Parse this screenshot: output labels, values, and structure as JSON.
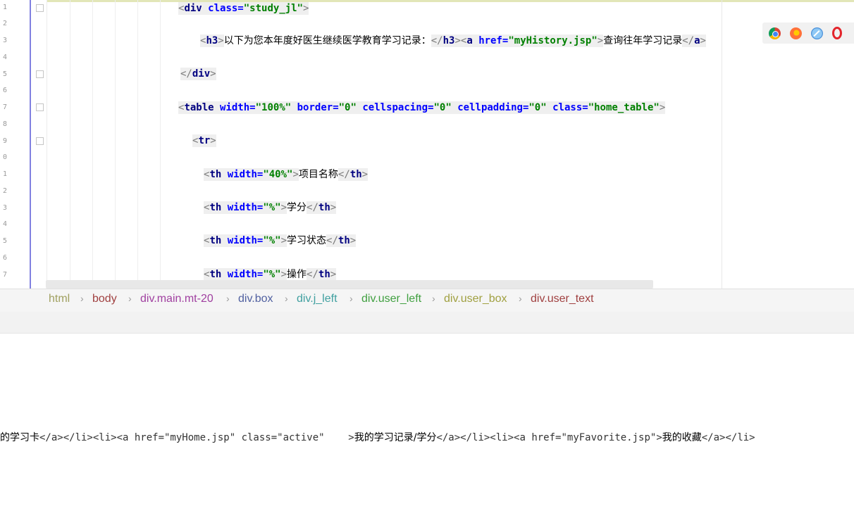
{
  "editor": {
    "line_numbers": [
      "1",
      "2",
      "3",
      "4",
      "5",
      "6",
      "7",
      "8",
      "9",
      "0",
      "1",
      "2",
      "3",
      "4",
      "5",
      "6",
      "7"
    ],
    "lines": {
      "l1": {
        "open": "<",
        "tag": "div",
        "a1": " class=",
        "v1": "\"study_jl\"",
        "close": ">"
      },
      "l3": {
        "o1": "<",
        "t1": "h3",
        "c1": ">",
        "text1": "以下为您本年度好医生继续医学教育学习记录：",
        "o2": "</",
        "t2": "h3",
        "c2": ">",
        "o3": "<",
        "t3": "a",
        "a3": " href=",
        "v3": "\"myHistory.jsp\"",
        "c3": ">",
        "text2": "查询往年学习记录",
        "o4": "</",
        "t4": "a",
        "c4": ">"
      },
      "l5": {
        "open": "</",
        "tag": "div",
        "close": ">"
      },
      "l7": {
        "open": "<",
        "tag": "table",
        "a1": " width=",
        "v1": "\"100%\"",
        "a2": " border=",
        "v2": "\"0\"",
        "a3": " cellspacing=",
        "v3": "\"0\"",
        "a4": " cellpadding=",
        "v4": "\"0\"",
        "a5": " class=",
        "v5": "\"home_table\"",
        "close": ">"
      },
      "l9": {
        "open": "<",
        "tag": "tr",
        "close": ">"
      },
      "l11": {
        "open": "<",
        "tag": "th",
        "a1": " width=",
        "v1": "\"40%\"",
        "close": ">",
        "text": "项目名称",
        "eo": "</",
        "etag": "th",
        "ec": ">"
      },
      "l13": {
        "open": "<",
        "tag": "th",
        "a1": " width=",
        "v1": "\"%\"",
        "close": ">",
        "text": "学分",
        "eo": "</",
        "etag": "th",
        "ec": ">"
      },
      "l15": {
        "open": "<",
        "tag": "th",
        "a1": " width=",
        "v1": "\"%\"",
        "close": ">",
        "text": "学习状态",
        "eo": "</",
        "etag": "th",
        "ec": ">"
      },
      "l17": {
        "open": "<",
        "tag": "th",
        "a1": " width=",
        "v1": "\"%\"",
        "close": ">",
        "text": "操作",
        "eo": "</",
        "etag": "th",
        "ec": ">"
      }
    }
  },
  "browser_icons": [
    "chrome-icon",
    "firefox-icon",
    "safari-icon",
    "opera-icon"
  ],
  "breadcrumb": {
    "items": [
      {
        "label": "html",
        "color": "#a0a060"
      },
      {
        "label": "body",
        "color": "#a04040"
      },
      {
        "label": "div.main.mt-20",
        "color": "#a040a0"
      },
      {
        "label": "div.box",
        "color": "#5060a0"
      },
      {
        "label": "div.j_left",
        "color": "#40a0a0"
      },
      {
        "label": "div.user_left",
        "color": "#40a040"
      },
      {
        "label": "div.user_box",
        "color": "#a0a040"
      },
      {
        "label": "div.user_text",
        "color": "#a04040"
      }
    ],
    "separator": "›"
  },
  "bottom_line": {
    "p1": "的学习卡",
    "p2": "</a></li><li><a href=\"myHome.jsp\" class=\"active\"    >",
    "p3": "我的学习记录/学分",
    "p4": "</a></li><li><a href=\"myFavorite.jsp\">",
    "p5": "我的收藏",
    "p6": "</a></li>"
  }
}
